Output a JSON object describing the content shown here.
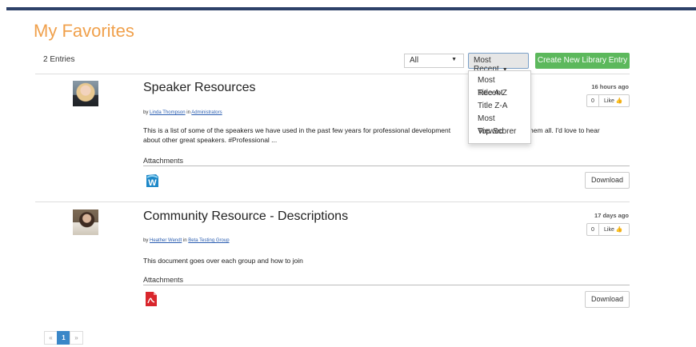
{
  "page": {
    "title": "My Favorites",
    "entries_count": "2 Entries"
  },
  "toolbar": {
    "filter_value": "All",
    "sort_label": "Most Recent",
    "create_label": "Create New Library Entry"
  },
  "sort_menu": {
    "options": [
      "Most Recent",
      "Title A-Z",
      "Title Z-A",
      "Most Viewed",
      "Top Scorer"
    ]
  },
  "entries": [
    {
      "title": "Speaker Resources",
      "by": "by",
      "author": "Linda Thompson",
      "in": "in",
      "group": "Administrators",
      "description_1": "This is a list of some of the speakers we have used in the past few years for professional development",
      "description_2": "nd them all.  I'd love to hear",
      "description_3": "about other great speakers. #Professional ...",
      "attachments_label": "Attachments",
      "time": "16 hours ago",
      "like_count": "0",
      "like_label": "Like",
      "download_label": "Download",
      "attachment_icon": "word-doc-icon"
    },
    {
      "title": "Community Resource - Descriptions",
      "by": "by",
      "author": "Heather Wendt",
      "in": "in",
      "group": "Beta Testing Group",
      "description_1": "This document goes over each group and how to join",
      "attachments_label": "Attachments",
      "time": "17 days ago",
      "like_count": "0",
      "like_label": "Like",
      "download_label": "Download",
      "attachment_icon": "pdf-icon"
    }
  ],
  "pagination": {
    "prev": "«",
    "current": "1",
    "next": "»"
  },
  "colors": {
    "title": "#f0a04b",
    "create_button": "#5cb85c",
    "active_page": "#3a87c8",
    "top_bar": "#2d4169"
  }
}
